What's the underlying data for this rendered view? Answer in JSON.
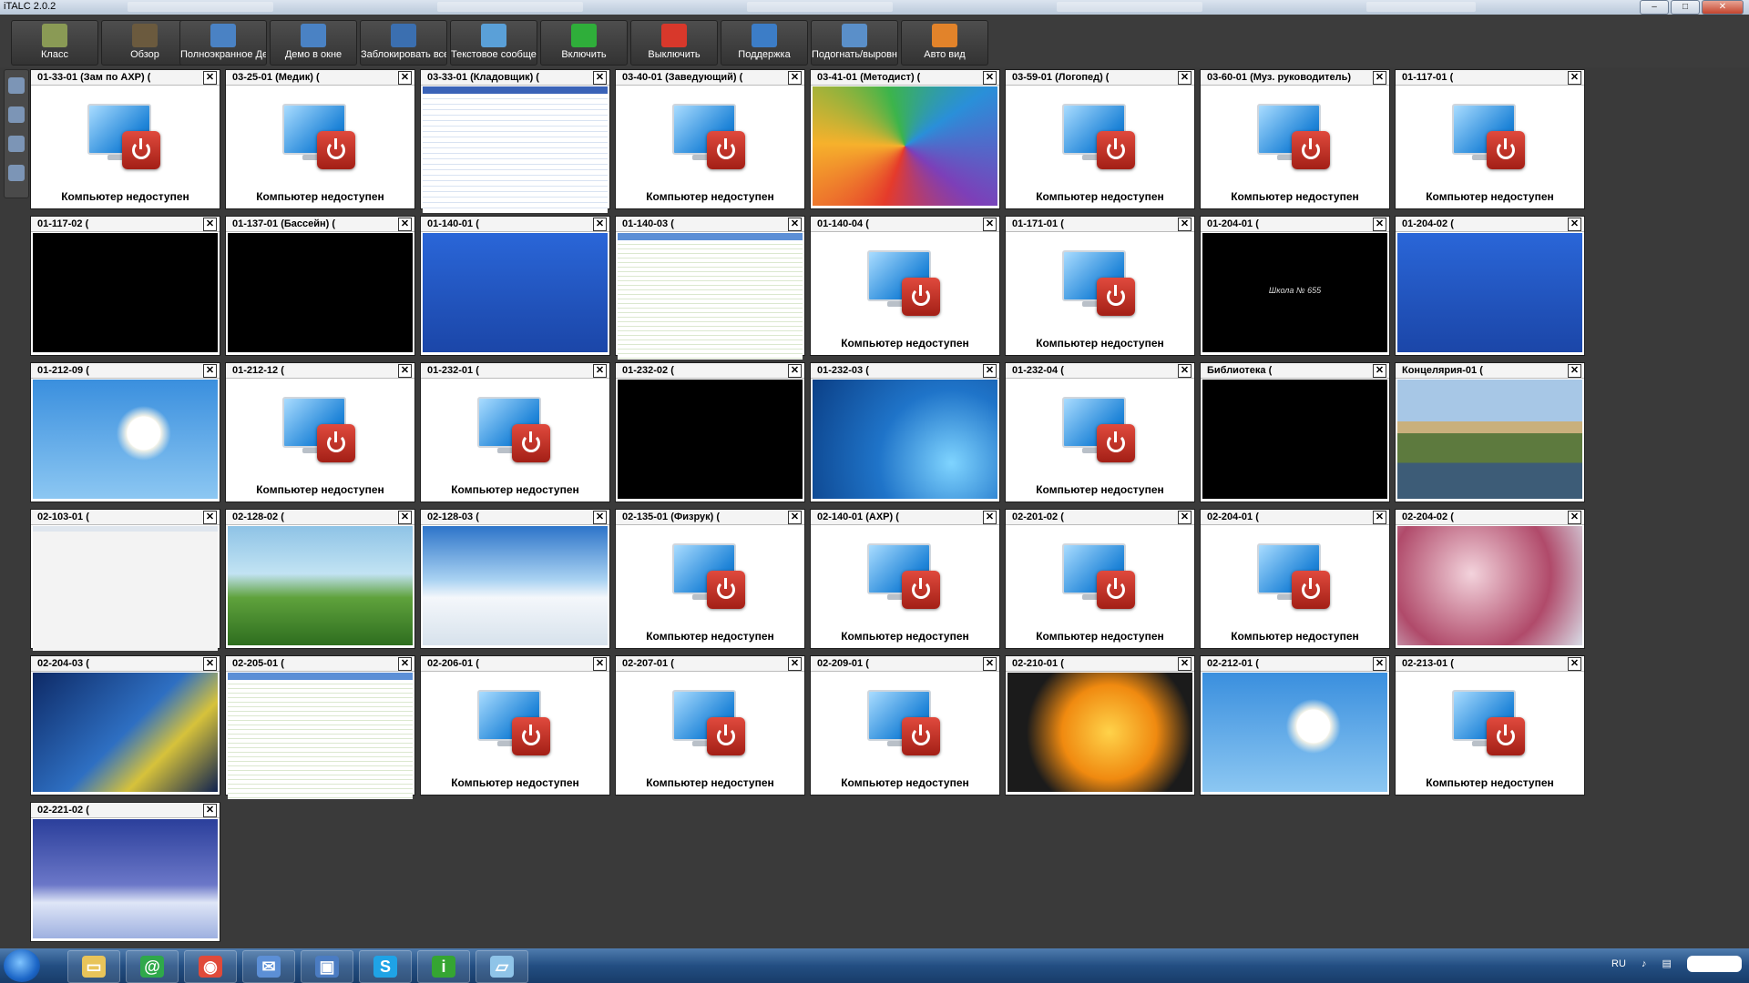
{
  "window": {
    "title": "iTALC 2.0.2",
    "buttons": [
      "–",
      "□",
      "✕"
    ]
  },
  "toolbar": {
    "buttons": [
      {
        "label": "Класс",
        "icon": "classroom-icon",
        "color": "#8a9a55"
      },
      {
        "label": "Обзор",
        "icon": "binoculars-icon",
        "color": "#6b5a3e"
      },
      {
        "label": "Полноэкранное Демо",
        "icon": "fullscreen-demo-icon",
        "color": "#4a82c4"
      },
      {
        "label": "Демо в окне",
        "icon": "window-demo-icon",
        "color": "#4a82c4"
      },
      {
        "label": "Заблокировать все",
        "icon": "lock-screen-icon",
        "color": "#3b6fb0"
      },
      {
        "label": "Текстовое сообщение",
        "icon": "text-message-icon",
        "color": "#5aa0d8"
      },
      {
        "label": "Включить",
        "icon": "power-on-icon",
        "color": "#2fae3a"
      },
      {
        "label": "Выключить",
        "icon": "power-off-icon",
        "color": "#d8382b"
      },
      {
        "label": "Поддержка",
        "icon": "support-icon",
        "color": "#3c7dc7"
      },
      {
        "label": "Подогнать/выровнять",
        "icon": "zoom-align-icon",
        "color": "#5a8fc9"
      },
      {
        "label": "Авто вид",
        "icon": "auto-view-icon",
        "color": "#e2832a"
      }
    ]
  },
  "unavailable_text": "Компьютер недоступен",
  "tiles": [
    {
      "name": "01-33-01 (Зам по АХР) (",
      "screen": "off"
    },
    {
      "name": "03-25-01 (Медик) (",
      "screen": "off"
    },
    {
      "name": "03-33-01 (Кладовщик) (",
      "screen": "sheet"
    },
    {
      "name": "03-40-01 (Заведующий) (",
      "screen": "off"
    },
    {
      "name": "03-41-01 (Методист) (",
      "screen": "swirl"
    },
    {
      "name": "03-59-01 (Логопед) (",
      "screen": "off"
    },
    {
      "name": "03-60-01 (Муз. руководитель)",
      "screen": "off"
    },
    {
      "name": "01-117-01 (",
      "screen": "off"
    },
    {
      "name": "01-117-02 (",
      "screen": "black"
    },
    {
      "name": "01-137-01 (Бассейн) (",
      "screen": "black"
    },
    {
      "name": "01-140-01 (",
      "screen": "xp"
    },
    {
      "name": "01-140-03 (",
      "screen": "sheet2"
    },
    {
      "name": "01-140-04 (",
      "screen": "off"
    },
    {
      "name": "01-171-01 (",
      "screen": "off"
    },
    {
      "name": "01-204-01 (",
      "screen": "black",
      "caption": "Школа № 655"
    },
    {
      "name": "01-204-02 (",
      "screen": "xp"
    },
    {
      "name": "01-212-09 (",
      "screen": "daisy"
    },
    {
      "name": "01-212-12 (",
      "screen": "off"
    },
    {
      "name": "01-232-01 (",
      "screen": "off"
    },
    {
      "name": "01-232-02 (",
      "screen": "black"
    },
    {
      "name": "01-232-03 (",
      "screen": "win7"
    },
    {
      "name": "01-232-04 (",
      "screen": "off"
    },
    {
      "name": "Библиотека (",
      "screen": "black"
    },
    {
      "name": "Концелярия-01 (",
      "screen": "park"
    },
    {
      "name": "02-103-01 (",
      "screen": "white"
    },
    {
      "name": "02-128-02 (",
      "screen": "needle"
    },
    {
      "name": "02-128-03 (",
      "screen": "snow"
    },
    {
      "name": "02-135-01 (Физрук) (",
      "screen": "off"
    },
    {
      "name": "02-140-01 (АХР) (",
      "screen": "off"
    },
    {
      "name": "02-201-02 (",
      "screen": "off"
    },
    {
      "name": "02-204-01 (",
      "screen": "off"
    },
    {
      "name": "02-204-02 (",
      "screen": "pink"
    },
    {
      "name": "02-204-03 (",
      "screen": "blueabs"
    },
    {
      "name": "02-205-01 (",
      "screen": "sheet2"
    },
    {
      "name": "02-206-01 (",
      "screen": "off"
    },
    {
      "name": "02-207-01 (",
      "screen": "off"
    },
    {
      "name": "02-209-01 (",
      "screen": "off"
    },
    {
      "name": "02-210-01 (",
      "screen": "flower"
    },
    {
      "name": "02-212-01 (",
      "screen": "daisy"
    },
    {
      "name": "02-213-01 (",
      "screen": "off"
    },
    {
      "name": "02-221-02 (",
      "screen": "winter"
    }
  ],
  "taskbar": {
    "items": [
      {
        "icon": "folder-icon",
        "glyph": "▭",
        "color": "#e8c45a"
      },
      {
        "icon": "mail-at-icon",
        "glyph": "@",
        "color": "#2fa84a"
      },
      {
        "icon": "chrome-icon",
        "glyph": "◉",
        "color": "#e04a3a"
      },
      {
        "icon": "thunderbird-icon",
        "glyph": "✉",
        "color": "#5c8fd6"
      },
      {
        "icon": "italc-icon",
        "glyph": "▣",
        "color": "#4b7cc2"
      },
      {
        "icon": "skype-icon",
        "glyph": "S",
        "color": "#1fa3e6"
      },
      {
        "icon": "info-icon",
        "glyph": "i",
        "color": "#35a532"
      },
      {
        "icon": "notes-icon",
        "glyph": "▱",
        "color": "#8fc4e8"
      }
    ],
    "language": "RU"
  }
}
